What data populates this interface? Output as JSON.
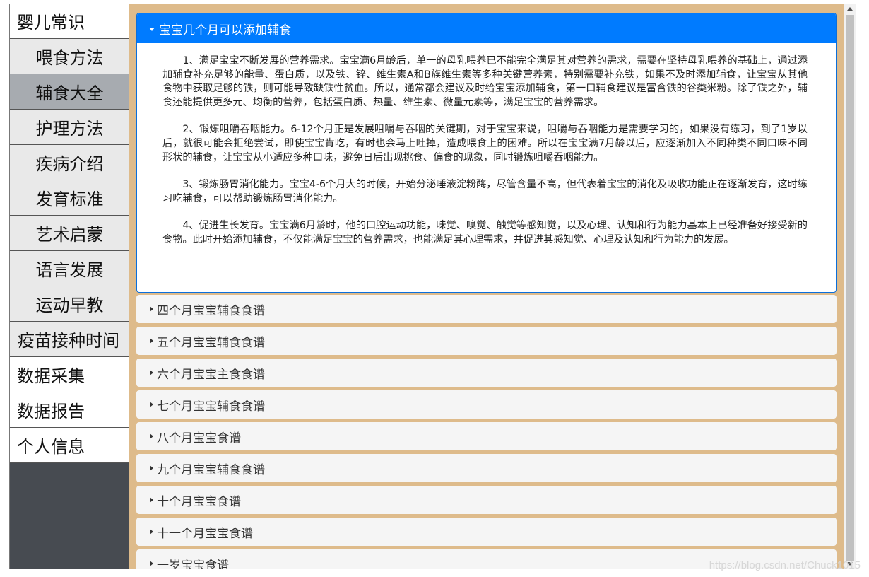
{
  "sidebar": {
    "items": [
      {
        "label": "婴儿常识",
        "type": "top"
      },
      {
        "label": "喂食方法",
        "type": "sub"
      },
      {
        "label": "辅食大全",
        "type": "sub-active"
      },
      {
        "label": "护理方法",
        "type": "sub"
      },
      {
        "label": "疾病介绍",
        "type": "sub"
      },
      {
        "label": "发育标准",
        "type": "sub"
      },
      {
        "label": "艺术启蒙",
        "type": "sub"
      },
      {
        "label": "语言发展",
        "type": "sub"
      },
      {
        "label": "运动早教",
        "type": "sub"
      },
      {
        "label": "疫苗接种时间",
        "type": "sub-wide"
      },
      {
        "label": "数据采集",
        "type": "top"
      },
      {
        "label": "数据报告",
        "type": "top"
      },
      {
        "label": "个人信息",
        "type": "top"
      }
    ]
  },
  "accordion": {
    "active_title": "宝宝几个月可以添加辅食",
    "active_paragraphs": [
      "1、满足宝宝不断发展的营养需求。宝宝满6月龄后，单一的母乳喂养已不能完全满足其对营养的需求，需要在坚持母乳喂养的基础上，通过添加辅食补充足够的能量、蛋白质，以及铁、锌、维生素A和B族维生素等多种关键营养素，特别需要补充铁，如果不及时添加辅食，让宝宝从其他食物中获取足够的铁，则可能导致缺铁性贫血。所以，通常都会建议及时给宝宝添加辅食，第一口辅食建议是富含铁的谷类米粉。除了铁之外，辅食还能提供更多元、均衡的营养，包括蛋白质、热量、维生素、微量元素等，满足宝宝的营养需求。",
      "2、锻炼咀嚼吞咽能力。6-12个月正是发展咀嚼与吞咽的关键期，对于宝宝来说，咀嚼与吞咽能力是需要学习的，如果没有练习，到了1岁以后，就很可能会拒绝尝试，即使宝宝肯吃，有时也会马上吐掉，造成喂食上的困难。所以在宝宝满7月龄以后，应逐渐加入不同种类不同口味不同形状的辅食，让宝宝从小适应多种口味，避免日后出现挑食、偏食的现象，同时锻炼咀嚼吞咽能力。",
      "3、锻炼肠胃消化能力。宝宝4-6个月大的时候，开始分泌唾液淀粉酶，尽管含量不高，但代表着宝宝的消化及吸收功能正在逐渐发育，这时练习吃辅食，可以帮助锻炼肠胃消化能力。",
      "4、促进生长发育。宝宝满6月龄时，他的口腔运动功能，味觉、嗅觉、触觉等感知觉，以及心理、认知和行为能力基本上已经准备好接受新的食物。此时开始添加辅食，不仅能满足宝宝的营养需求，也能满足其心理需求，并促进其感知觉、心理及认知和行为能力的发展。"
    ],
    "collapsed_titles": [
      "四个月宝宝辅食食谱",
      "五个月宝宝辅食食谱",
      "六个月宝宝主食食谱",
      "七个月宝宝辅食食谱",
      "八个月宝宝食谱",
      "九个月宝宝辅食食谱",
      "十个月宝宝食谱",
      "十一个月宝宝食谱",
      "一岁宝宝食谱"
    ]
  },
  "watermark": "https://blog.csdn.net/Chuck1015"
}
